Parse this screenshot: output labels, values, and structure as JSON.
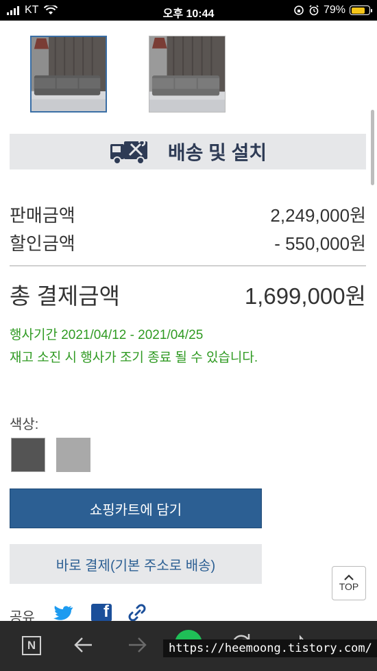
{
  "status_bar": {
    "carrier": "KT",
    "time": "오후 10:44",
    "battery": "79%",
    "battery_level": 0.79
  },
  "gallery": {
    "thumbnails": [
      {
        "alt": "sofa-thumbnail-1",
        "selected": true
      },
      {
        "alt": "sofa-thumbnail-2",
        "selected": false
      }
    ]
  },
  "shipping": {
    "label": "배송 및 설치",
    "icon": "delivery-truck-tools-icon"
  },
  "pricing": {
    "sale_label": "판매금액",
    "sale_value": "2,249,000원",
    "discount_label": "할인금액",
    "discount_value": "- 550,000원",
    "total_label": "총 결제금액",
    "total_value": "1,699,000원"
  },
  "promotion": {
    "period": "행사기간 2021/04/12 - 2021/04/25",
    "notice": "재고 소진 시 행사가 조기 종료 될 수 있습니다."
  },
  "color": {
    "label": "색상:",
    "options": [
      {
        "name": "dark-gray",
        "hex": "#545454"
      },
      {
        "name": "light-gray",
        "hex": "#a9a9a9"
      }
    ]
  },
  "actions": {
    "cart_label": "쇼핑카트에 담기",
    "buy_label": "바로 결제(기본 주소로 배송)",
    "top_label": "TOP"
  },
  "share": {
    "label": "공유",
    "icons": [
      "twitter-icon",
      "facebook-icon",
      "link-icon"
    ]
  },
  "browser_bar": {
    "icons": [
      "naver-n-icon",
      "back-arrow-icon",
      "forward-arrow-icon",
      "home-icon",
      "refresh-icon",
      "share-icon",
      "more-icon"
    ]
  },
  "watermark": {
    "text": "https://heemoong.tistory.com/"
  },
  "colors": {
    "accent": "#2c5f93",
    "promo_green": "#2f9a22",
    "banner_bg": "#e6e7e9"
  }
}
